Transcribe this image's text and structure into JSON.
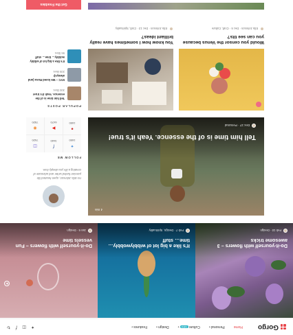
{
  "header": {
    "brand": "Gorgo",
    "nav": [
      {
        "label": "Home",
        "has_caret": false,
        "active": true
      },
      {
        "label": "Personal",
        "has_caret": true,
        "active": false
      },
      {
        "label": "Culture",
        "has_caret": true,
        "active": false,
        "badge": "NEW"
      },
      {
        "label": "Design",
        "has_caret": true,
        "active": false
      },
      {
        "label": "Features",
        "has_caret": true,
        "active": false
      }
    ],
    "socials": [
      "twitter-icon",
      "instagram-icon",
      "facebook-icon",
      "refresh-icon"
    ]
  },
  "featured": [
    {
      "title": "Do-it-yourself with flowers – 3 awesome tricks",
      "meta": "Feb 10 · Design"
    },
    {
      "title": "It’s like a big lot of wibblywobbly… time… stuff",
      "meta": "Feb 7 · Design, Spirituality"
    },
    {
      "title": "Do-it-yourself with flowers – Fun vessels time",
      "meta": "Jan 6 · Design"
    }
  ],
  "hero": {
    "title": "Tell him time is of the essence. Yeah it’s true!",
    "meta": "Dec 27 · Personal",
    "stats": "4 min"
  },
  "cards": [
    {
      "title": "Would you censor the Venus because you can see tits?",
      "meta": "Ella Johnson · Dec 6 · Craft, Culture"
    },
    {
      "title": "You know how I sometimes have really brilliant ideas?",
      "meta": "Ella Johnson · Dec 13 · Craft, Spirituality"
    }
  ],
  "sidebar": {
    "author_bio": "I'm Ella Johnson, open-hearted life passion-fueled writer and advocate of creating a life you deeply love.",
    "follow_heading": "FOLLOW ME",
    "socials": [
      {
        "icon": "twitter-icon",
        "count": "1650"
      },
      {
        "icon": "facebook-icon",
        "count": "3440"
      },
      {
        "icon": "instagram-icon",
        "count": "7620"
      },
      {
        "icon": "pinterest-icon",
        "count": "1650"
      },
      {
        "icon": "youtube-icon",
        "count": "6470"
      },
      {
        "icon": "rss-icon",
        "count": "7820"
      }
    ],
    "popular_heading": "POPULAR POSTS",
    "popular": [
      {
        "title": "Tell him time is of the essence. Yeah it’s true!",
        "meta": "300 likes"
      },
      {
        "title": "NYC – We loved Rosa (and always)!",
        "meta": "205 likes"
      },
      {
        "title": "It’s like a big lot of wibbly wobbly… time… stuff",
        "meta": "96 likes"
      }
    ],
    "cta": "Get the Freebies"
  },
  "colors": {
    "accent": "#e8484d",
    "badge": "#2bb5c7",
    "cta": "#ef5b66"
  }
}
